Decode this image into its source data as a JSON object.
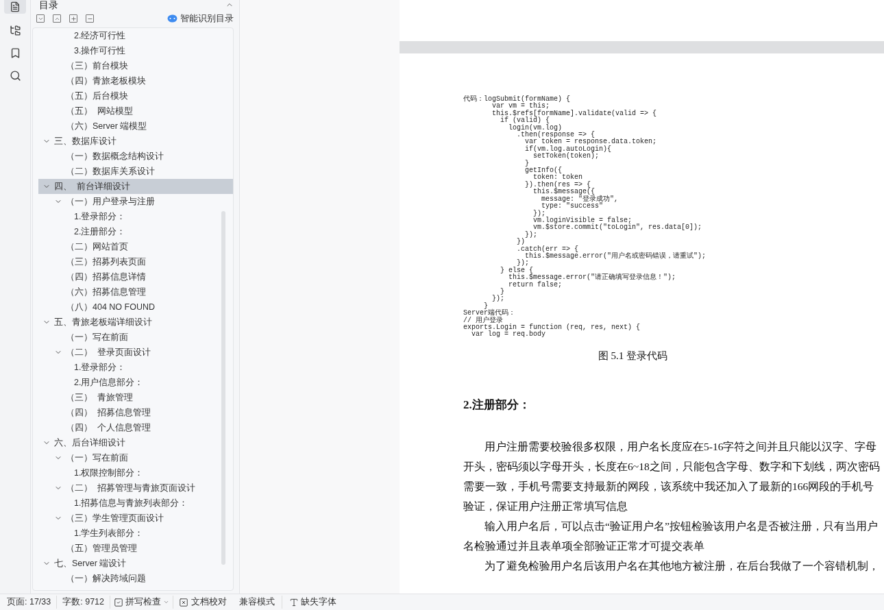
{
  "panel": {
    "title": "目录",
    "smart_toc": "智能识别目录"
  },
  "outline": [
    {
      "children": [
        {
          "children": [
            {
              "label": "2.经济可行性"
            },
            {
              "label": "3.操作可行性"
            }
          ]
        },
        {
          "label": "（三）前台模块"
        },
        {
          "label": "（四）青旅老板模块"
        },
        {
          "label": "（五）后台模块"
        },
        {
          "label": "（五）  网站模型"
        },
        {
          "label": "（六）Server 端模型"
        }
      ]
    },
    {
      "label": "三、数据库设计",
      "expanded": true,
      "selected": false,
      "children": [
        {
          "label": "（一）数据概念结构设计"
        },
        {
          "label": "（二）数据库关系设计"
        }
      ]
    },
    {
      "label": "四、  前台详细设计",
      "expanded": true,
      "selected": true,
      "children": [
        {
          "label": "（一）用户登录与注册",
          "expanded": true,
          "children": [
            {
              "label": "1.登录部分："
            },
            {
              "label": "2.注册部分："
            }
          ]
        },
        {
          "label": "（二）网站首页"
        },
        {
          "label": "（三）招募列表页面"
        },
        {
          "label": "（四）招募信息详情"
        },
        {
          "label": "（六）招募信息管理"
        },
        {
          "label": "（八）404 NO FOUND"
        }
      ]
    },
    {
      "label": "五、青旅老板端详细设计",
      "expanded": true,
      "selected": false,
      "children": [
        {
          "label": "（一）写在前面"
        },
        {
          "label": "（二）  登录页面设计",
          "expanded": true,
          "children": [
            {
              "label": "1.登录部分："
            },
            {
              "label": "2.用户信息部分："
            }
          ]
        },
        {
          "label": "（三）  青旅管理"
        },
        {
          "label": "（四）  招募信息管理"
        },
        {
          "label": "（四）  个人信息管理"
        }
      ]
    },
    {
      "label": "六、后台详细设计",
      "expanded": true,
      "selected": false,
      "children": [
        {
          "label": "（一）写在前面",
          "expanded": true,
          "children": [
            {
              "label": "1.权限控制部分："
            }
          ]
        },
        {
          "label": "（二）  招募管理与青旅页面设计",
          "expanded": true,
          "children": [
            {
              "label": "1.招募信息与青旅列表部分："
            }
          ]
        },
        {
          "label": "（三）学生管理页面设计",
          "expanded": true,
          "children": [
            {
              "label": "1.学生列表部分："
            }
          ]
        },
        {
          "label": "（五）管理员管理"
        }
      ]
    },
    {
      "label": "七、Server 端设计",
      "expanded": true,
      "selected": false,
      "children": [
        {
          "label": "（一）解决跨域问题"
        }
      ]
    }
  ],
  "document": {
    "code_lines": [
      "代码：logSubmit(formName) {",
      "       var vm = this;",
      "       this.$refs[formName].validate(valid => {",
      "         if (valid) {",
      "           login(vm.log)",
      "             .then(response => {",
      "               var token = response.data.token;",
      "               if(vm.log.autoLogin){",
      "                 setToken(token);",
      "               }",
      "               getInfo({",
      "                 token: token",
      "               }).then(res => {",
      "                 this.$message({",
      "                   message: \"登录成功\",",
      "                   type: \"success\"",
      "                 });",
      "                 vm.loginVisible = false;",
      "                 vm.$store.commit(\"toLogin\", res.data[0]);",
      "               });",
      "             })",
      "             .catch(err => {",
      "               this.$message.error(\"用户名或密码错误，请重试\");",
      "             });",
      "         } else {",
      "           this.$message.error(\"请正确填写登录信息！\");",
      "           return false;",
      "         }",
      "       });",
      "     }",
      "Server端代码：",
      "// 用户登录",
      "exports.Login = function (req, res, next) {",
      "  var log = req.body"
    ],
    "caption": "图 5.1 登录代码",
    "heading": "2.注册部分：",
    "paragraphs": [
      "用户注册需要校验很多权限，用户名长度应在5-16字符之间并且只能以汉字、字母开头，密码须以字母开头，长度在6~18之间，只能包含字母、数字和下划线，两次密码需要一致，手机号需要支持最新的网段，该系统中我还加入了最新的166网段的手机号验证，保证用户注册正常填写信息",
      "输入用户名后，可以点击“验证用户名”按钮检验该用户名是否被注册，只有当用户名检验通过并且表单项全部验证正常才可提交表单",
      "为了避免检验用户名后该用户名在其他地方被注册，在后台我做了一个容错机制，"
    ]
  },
  "status_bar": {
    "page": "页面: 17/33",
    "words": "字数: 9712",
    "spell_check": "拼写检查",
    "proofread": "文档校对",
    "compat": "兼容模式",
    "missing_fonts": "缺失字体"
  }
}
